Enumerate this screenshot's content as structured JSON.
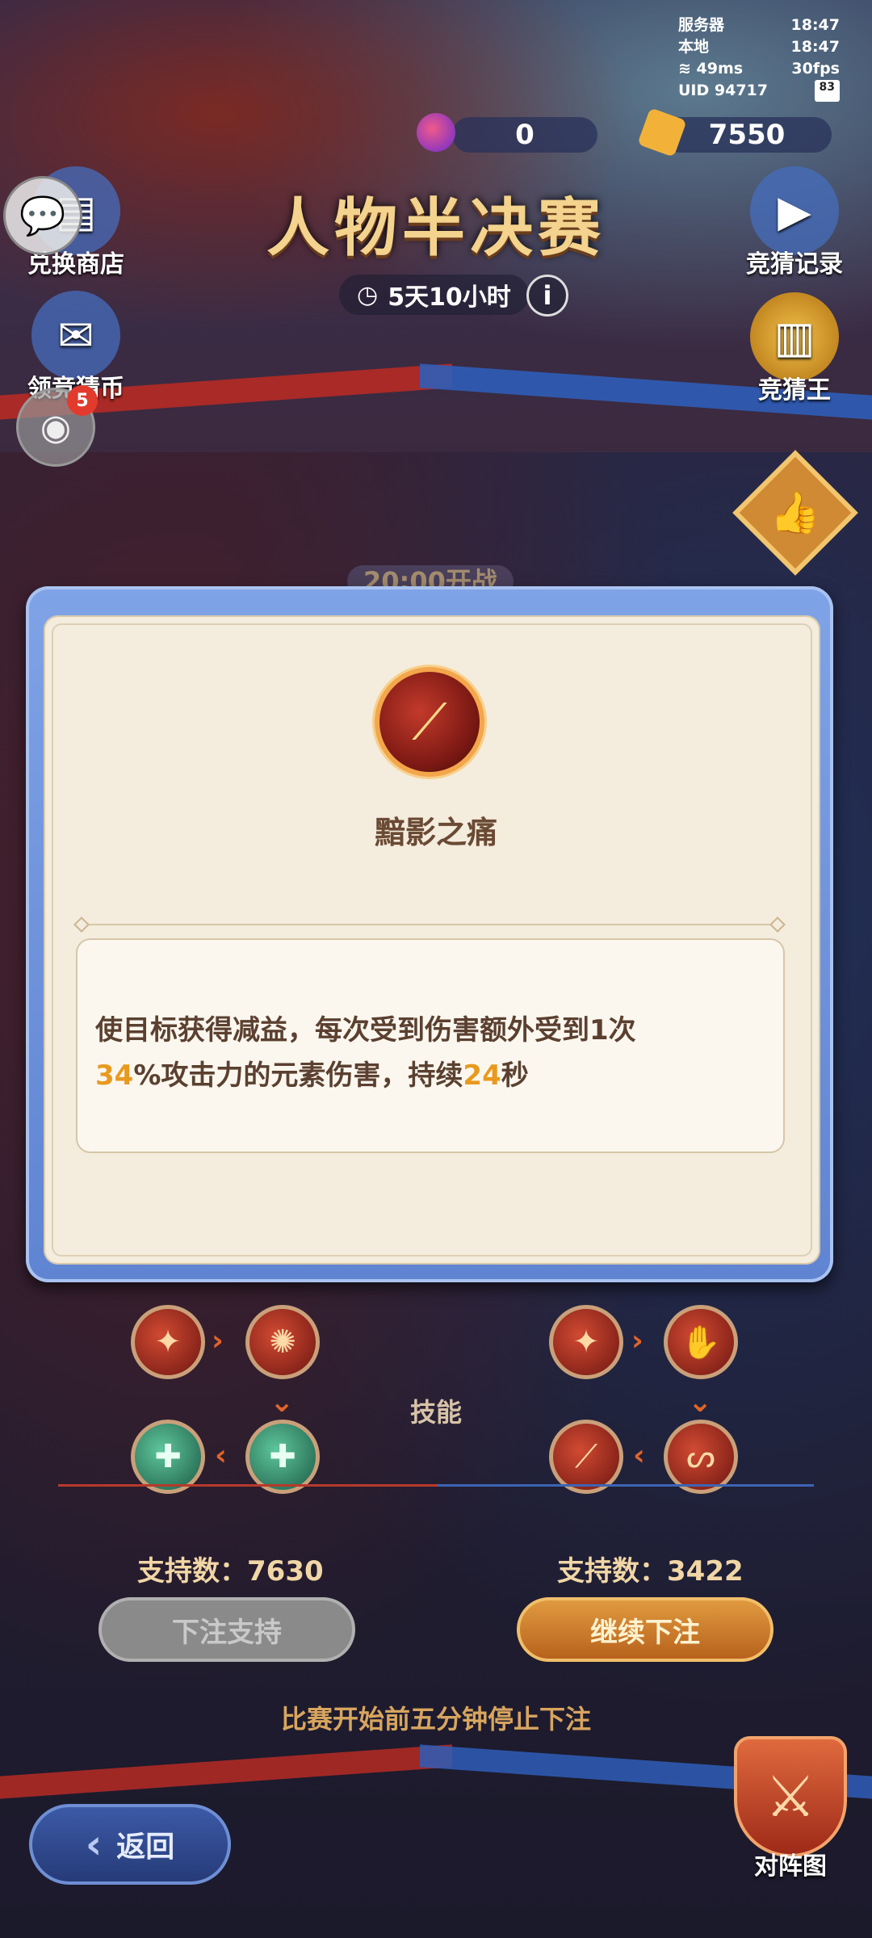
{
  "status": {
    "server_label": "服务器",
    "server_time": "18:47",
    "local_label": "本地",
    "local_time": "18:47",
    "ping": "49ms",
    "fps": "30fps",
    "uid": "UID 94717",
    "battery": "83"
  },
  "currency": {
    "gems": "0",
    "tickets": "7550"
  },
  "header": {
    "title": "人物半决赛",
    "timer": "5天10小时",
    "info": "i"
  },
  "side_buttons": {
    "exchange_shop": "兑换商店",
    "claim_coins": "领竞猜币",
    "guess_record": "竞猜记录",
    "guess_king": "竞猜王",
    "notification_count": "5"
  },
  "match": {
    "start_time": "20:00开战"
  },
  "popup": {
    "skill_name": "黯影之痛",
    "desc_1": "使目标获得减益，每次受到伤害额外受到1次",
    "desc_hl1": "34",
    "desc_2": "%攻击力的元素伤害，持续",
    "desc_hl2": "24",
    "desc_3": "秒"
  },
  "skills": {
    "label": "技能"
  },
  "left_team": {
    "support_label": "支持数：7630",
    "bet_button": "下注支持"
  },
  "right_team": {
    "support_label": "支持数：3422",
    "bet_button": "继续下注"
  },
  "notice": "比赛开始前五分钟停止下注",
  "footer": {
    "back": "返回",
    "lineup": "对阵图"
  },
  "colors": {
    "accent": "#e89a1f",
    "red_team": "#b62a25",
    "blue_team": "#2f5db8"
  }
}
